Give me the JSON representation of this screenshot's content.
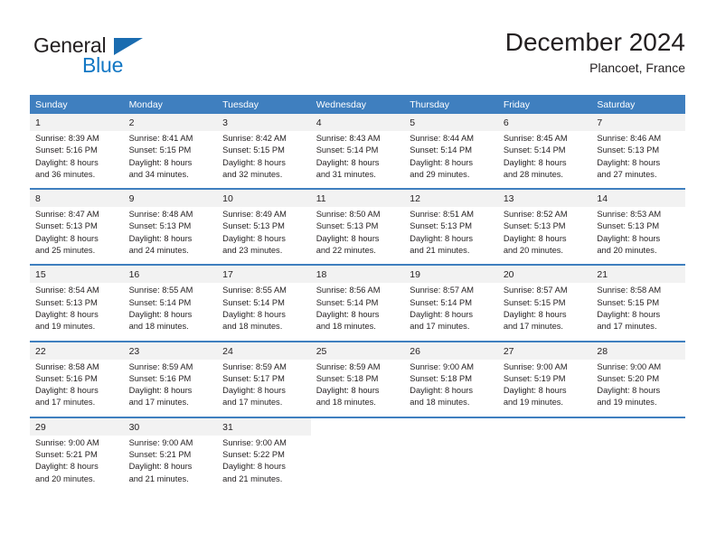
{
  "logo": {
    "word_top": "General",
    "word_bottom": "Blue",
    "triangle_color": "#1a6cb0",
    "blue_color": "#1277c4"
  },
  "header": {
    "title": "December 2024",
    "subtitle": "Plancoet, France",
    "header_bg": "#3f7fbf",
    "daynum_bg": "#f2f2f2"
  },
  "weekdays": [
    "Sunday",
    "Monday",
    "Tuesday",
    "Wednesday",
    "Thursday",
    "Friday",
    "Saturday"
  ],
  "weeks": [
    [
      {
        "day": "1",
        "sunrise": "Sunrise: 8:39 AM",
        "sunset": "Sunset: 5:16 PM",
        "daylight_1": "Daylight: 8 hours",
        "daylight_2": "and 36 minutes."
      },
      {
        "day": "2",
        "sunrise": "Sunrise: 8:41 AM",
        "sunset": "Sunset: 5:15 PM",
        "daylight_1": "Daylight: 8 hours",
        "daylight_2": "and 34 minutes."
      },
      {
        "day": "3",
        "sunrise": "Sunrise: 8:42 AM",
        "sunset": "Sunset: 5:15 PM",
        "daylight_1": "Daylight: 8 hours",
        "daylight_2": "and 32 minutes."
      },
      {
        "day": "4",
        "sunrise": "Sunrise: 8:43 AM",
        "sunset": "Sunset: 5:14 PM",
        "daylight_1": "Daylight: 8 hours",
        "daylight_2": "and 31 minutes."
      },
      {
        "day": "5",
        "sunrise": "Sunrise: 8:44 AM",
        "sunset": "Sunset: 5:14 PM",
        "daylight_1": "Daylight: 8 hours",
        "daylight_2": "and 29 minutes."
      },
      {
        "day": "6",
        "sunrise": "Sunrise: 8:45 AM",
        "sunset": "Sunset: 5:14 PM",
        "daylight_1": "Daylight: 8 hours",
        "daylight_2": "and 28 minutes."
      },
      {
        "day": "7",
        "sunrise": "Sunrise: 8:46 AM",
        "sunset": "Sunset: 5:13 PM",
        "daylight_1": "Daylight: 8 hours",
        "daylight_2": "and 27 minutes."
      }
    ],
    [
      {
        "day": "8",
        "sunrise": "Sunrise: 8:47 AM",
        "sunset": "Sunset: 5:13 PM",
        "daylight_1": "Daylight: 8 hours",
        "daylight_2": "and 25 minutes."
      },
      {
        "day": "9",
        "sunrise": "Sunrise: 8:48 AM",
        "sunset": "Sunset: 5:13 PM",
        "daylight_1": "Daylight: 8 hours",
        "daylight_2": "and 24 minutes."
      },
      {
        "day": "10",
        "sunrise": "Sunrise: 8:49 AM",
        "sunset": "Sunset: 5:13 PM",
        "daylight_1": "Daylight: 8 hours",
        "daylight_2": "and 23 minutes."
      },
      {
        "day": "11",
        "sunrise": "Sunrise: 8:50 AM",
        "sunset": "Sunset: 5:13 PM",
        "daylight_1": "Daylight: 8 hours",
        "daylight_2": "and 22 minutes."
      },
      {
        "day": "12",
        "sunrise": "Sunrise: 8:51 AM",
        "sunset": "Sunset: 5:13 PM",
        "daylight_1": "Daylight: 8 hours",
        "daylight_2": "and 21 minutes."
      },
      {
        "day": "13",
        "sunrise": "Sunrise: 8:52 AM",
        "sunset": "Sunset: 5:13 PM",
        "daylight_1": "Daylight: 8 hours",
        "daylight_2": "and 20 minutes."
      },
      {
        "day": "14",
        "sunrise": "Sunrise: 8:53 AM",
        "sunset": "Sunset: 5:13 PM",
        "daylight_1": "Daylight: 8 hours",
        "daylight_2": "and 20 minutes."
      }
    ],
    [
      {
        "day": "15",
        "sunrise": "Sunrise: 8:54 AM",
        "sunset": "Sunset: 5:13 PM",
        "daylight_1": "Daylight: 8 hours",
        "daylight_2": "and 19 minutes."
      },
      {
        "day": "16",
        "sunrise": "Sunrise: 8:55 AM",
        "sunset": "Sunset: 5:14 PM",
        "daylight_1": "Daylight: 8 hours",
        "daylight_2": "and 18 minutes."
      },
      {
        "day": "17",
        "sunrise": "Sunrise: 8:55 AM",
        "sunset": "Sunset: 5:14 PM",
        "daylight_1": "Daylight: 8 hours",
        "daylight_2": "and 18 minutes."
      },
      {
        "day": "18",
        "sunrise": "Sunrise: 8:56 AM",
        "sunset": "Sunset: 5:14 PM",
        "daylight_1": "Daylight: 8 hours",
        "daylight_2": "and 18 minutes."
      },
      {
        "day": "19",
        "sunrise": "Sunrise: 8:57 AM",
        "sunset": "Sunset: 5:14 PM",
        "daylight_1": "Daylight: 8 hours",
        "daylight_2": "and 17 minutes."
      },
      {
        "day": "20",
        "sunrise": "Sunrise: 8:57 AM",
        "sunset": "Sunset: 5:15 PM",
        "daylight_1": "Daylight: 8 hours",
        "daylight_2": "and 17 minutes."
      },
      {
        "day": "21",
        "sunrise": "Sunrise: 8:58 AM",
        "sunset": "Sunset: 5:15 PM",
        "daylight_1": "Daylight: 8 hours",
        "daylight_2": "and 17 minutes."
      }
    ],
    [
      {
        "day": "22",
        "sunrise": "Sunrise: 8:58 AM",
        "sunset": "Sunset: 5:16 PM",
        "daylight_1": "Daylight: 8 hours",
        "daylight_2": "and 17 minutes."
      },
      {
        "day": "23",
        "sunrise": "Sunrise: 8:59 AM",
        "sunset": "Sunset: 5:16 PM",
        "daylight_1": "Daylight: 8 hours",
        "daylight_2": "and 17 minutes."
      },
      {
        "day": "24",
        "sunrise": "Sunrise: 8:59 AM",
        "sunset": "Sunset: 5:17 PM",
        "daylight_1": "Daylight: 8 hours",
        "daylight_2": "and 17 minutes."
      },
      {
        "day": "25",
        "sunrise": "Sunrise: 8:59 AM",
        "sunset": "Sunset: 5:18 PM",
        "daylight_1": "Daylight: 8 hours",
        "daylight_2": "and 18 minutes."
      },
      {
        "day": "26",
        "sunrise": "Sunrise: 9:00 AM",
        "sunset": "Sunset: 5:18 PM",
        "daylight_1": "Daylight: 8 hours",
        "daylight_2": "and 18 minutes."
      },
      {
        "day": "27",
        "sunrise": "Sunrise: 9:00 AM",
        "sunset": "Sunset: 5:19 PM",
        "daylight_1": "Daylight: 8 hours",
        "daylight_2": "and 19 minutes."
      },
      {
        "day": "28",
        "sunrise": "Sunrise: 9:00 AM",
        "sunset": "Sunset: 5:20 PM",
        "daylight_1": "Daylight: 8 hours",
        "daylight_2": "and 19 minutes."
      }
    ],
    [
      {
        "day": "29",
        "sunrise": "Sunrise: 9:00 AM",
        "sunset": "Sunset: 5:21 PM",
        "daylight_1": "Daylight: 8 hours",
        "daylight_2": "and 20 minutes."
      },
      {
        "day": "30",
        "sunrise": "Sunrise: 9:00 AM",
        "sunset": "Sunset: 5:21 PM",
        "daylight_1": "Daylight: 8 hours",
        "daylight_2": "and 21 minutes."
      },
      {
        "day": "31",
        "sunrise": "Sunrise: 9:00 AM",
        "sunset": "Sunset: 5:22 PM",
        "daylight_1": "Daylight: 8 hours",
        "daylight_2": "and 21 minutes."
      },
      {
        "day": "",
        "sunrise": "",
        "sunset": "",
        "daylight_1": "",
        "daylight_2": ""
      },
      {
        "day": "",
        "sunrise": "",
        "sunset": "",
        "daylight_1": "",
        "daylight_2": ""
      },
      {
        "day": "",
        "sunrise": "",
        "sunset": "",
        "daylight_1": "",
        "daylight_2": ""
      },
      {
        "day": "",
        "sunrise": "",
        "sunset": "",
        "daylight_1": "",
        "daylight_2": ""
      }
    ]
  ]
}
